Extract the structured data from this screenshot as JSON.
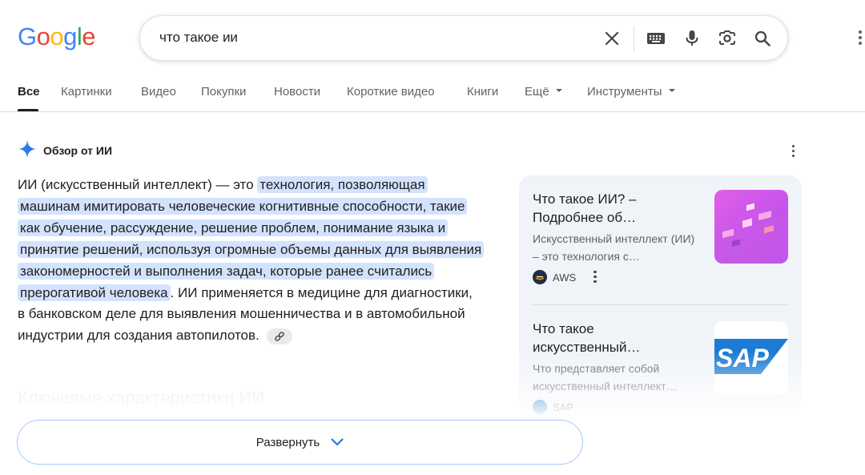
{
  "logo": {
    "letters": [
      "G",
      "o",
      "o",
      "g",
      "l",
      "e"
    ]
  },
  "search": {
    "query": "что такое ии",
    "icons": [
      "close-icon",
      "keyboard-icon",
      "mic-icon",
      "lens-icon",
      "search-icon"
    ]
  },
  "tabs": [
    {
      "label": "Все",
      "active": true
    },
    {
      "label": "Картинки"
    },
    {
      "label": "Видео"
    },
    {
      "label": "Покупки"
    },
    {
      "label": "Новости"
    },
    {
      "label": "Короткие видео"
    },
    {
      "label": "Книги"
    },
    {
      "label": "Ещё",
      "dropdown": true
    },
    {
      "label": "Инструменты",
      "dropdown": true
    }
  ],
  "ai_overview": {
    "header": "Обзор от ИИ",
    "intro": "ИИ (искусственный интеллект) — это ",
    "highlight": "технология, позволяющая машинам имитировать человеческие когнитивные способности, такие как обучение, рассуждение, решение проблем, понимание языка и принятие решений, используя огромные объемы данных для выявления закономерностей и выполнения задач, которые ранее считались прерогативой человека",
    "rest": ". ИИ применяется в медицине для диагностики, в банковском деле для выявления мошенничества и в автомобильной индустрии для создания автопилотов.",
    "faded_heading": "Ключевые характеристики ИИ",
    "expand_label": "Развернуть"
  },
  "sources": [
    {
      "title": "Что такое ИИ? – Подробнее об…",
      "snippet": "Искусственный интеллект (ИИ) – это технология с…",
      "site": "AWS"
    },
    {
      "title": "Что такое искусственный…",
      "snippet": "Что представляет собой искусственный интеллект…",
      "site": "SAP",
      "thumb_text": "SAP"
    }
  ],
  "colors": {
    "accent": "#1a73e8",
    "highlight": "#d3e3fd",
    "sources_bg": "#f0f4f9",
    "expand_border": "#a8c7fa"
  }
}
